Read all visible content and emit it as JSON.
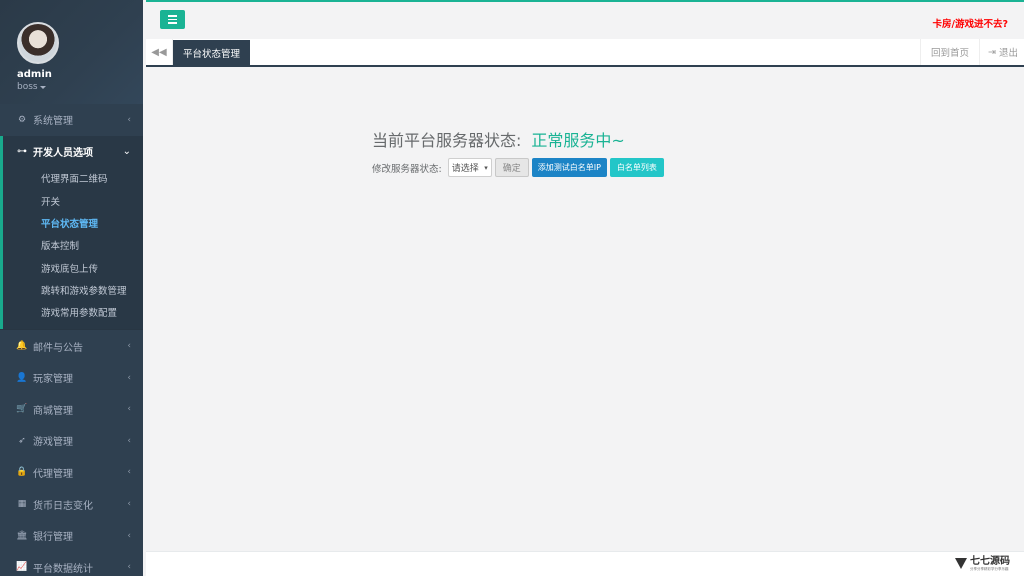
{
  "profile": {
    "name": "admin",
    "role": "boss"
  },
  "menu": [
    {
      "label": "系统管理",
      "icon": "gears-icon",
      "glyph": "⚙"
    },
    {
      "label": "开发人员选项",
      "icon": "gamepad-icon",
      "glyph": "⊶"
    },
    {
      "label": "邮件与公告",
      "icon": "bell-icon",
      "glyph": "🔔"
    },
    {
      "label": "玩家管理",
      "icon": "user-icon",
      "glyph": "👤"
    },
    {
      "label": "商城管理",
      "icon": "cart-icon",
      "glyph": "🛒"
    },
    {
      "label": "游戏管理",
      "icon": "rocket-icon",
      "glyph": "➶"
    },
    {
      "label": "代理管理",
      "icon": "lock-icon",
      "glyph": "🔒"
    },
    {
      "label": "货币日志变化",
      "icon": "calendar-icon",
      "glyph": "▦"
    },
    {
      "label": "银行管理",
      "icon": "bank-icon",
      "glyph": "🏛"
    },
    {
      "label": "平台数据统计",
      "icon": "chart-line-icon",
      "glyph": "📈"
    }
  ],
  "submenu": [
    "代理界面二维码",
    "开关",
    "平台状态管理",
    "版本控制",
    "游戏底包上传",
    "跳转和游戏参数管理",
    "游戏常用参数配置"
  ],
  "chevrons": {
    "collapsed": "‹",
    "expanded": "⌄"
  },
  "topbar": {
    "warning": "卡房/游戏进不去?"
  },
  "tabs": {
    "back_glyph": "◀◀",
    "active": "平台状态管理",
    "home": "回到首页",
    "logout": "退出"
  },
  "content": {
    "status_label": "当前平台服务器状态:",
    "status_value": "正常服务中~",
    "form_label": "修改服务器状态:",
    "select_value": "请选择",
    "confirm": "确定",
    "add_whitelist": "添加测试白名单IP",
    "whitelist_list": "白名单列表"
  },
  "footer": {
    "logo_main": "七七源码",
    "logo_sub": "分享分享精彩学分享乐趣"
  },
  "colors": {
    "accent": "#1ab394",
    "sidebar": "#2f4050",
    "blue": "#1c84c6",
    "cyan": "#23c6c8",
    "warn": "#ff0000",
    "active_sub": "#5fb9f5"
  }
}
